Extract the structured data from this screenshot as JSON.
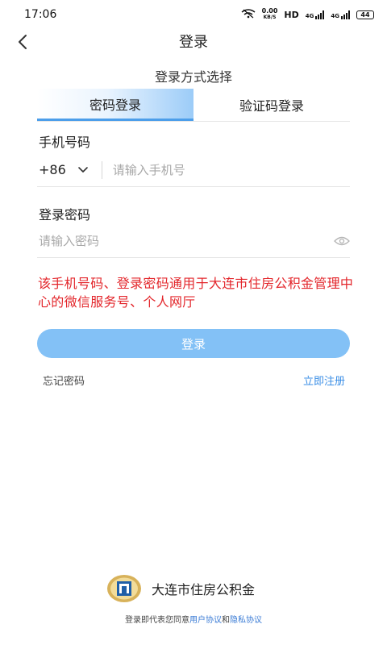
{
  "status_bar": {
    "time": "17:06",
    "net_speed_value": "0.00",
    "net_speed_unit": "KB/S",
    "hd_label": "HD",
    "net_type_1": "4G",
    "net_type_2": "4G",
    "battery_level": "44"
  },
  "nav": {
    "title": "登录",
    "back_icon": "chevron-left-icon"
  },
  "login_method_title": "登录方式选择",
  "tabs": [
    {
      "label": "密码登录",
      "active": true
    },
    {
      "label": "验证码登录",
      "active": false
    }
  ],
  "phone": {
    "label": "手机号码",
    "country_code": "+86",
    "placeholder": "请输入手机号",
    "value": ""
  },
  "password": {
    "label": "登录密码",
    "placeholder": "请输入密码",
    "value": "",
    "toggle_icon": "eye-icon"
  },
  "notice": "该手机号码、登录密码通用于大连市住房公积金管理中心的微信服务号、个人网厅",
  "login_button": "登录",
  "forgot_password": "忘记密码",
  "register": "立即注册",
  "brand": {
    "name": "大连市住房公积金",
    "logo_icon": "housing-fund-logo-icon"
  },
  "agreement": {
    "prefix": "登录即代表您同意",
    "user_agreement": "用户协议",
    "connector": "和",
    "privacy_agreement": "隐私协议"
  },
  "colors": {
    "accent": "#3a8ee6",
    "button": "#83c1f6",
    "notice": "#e3262b"
  }
}
